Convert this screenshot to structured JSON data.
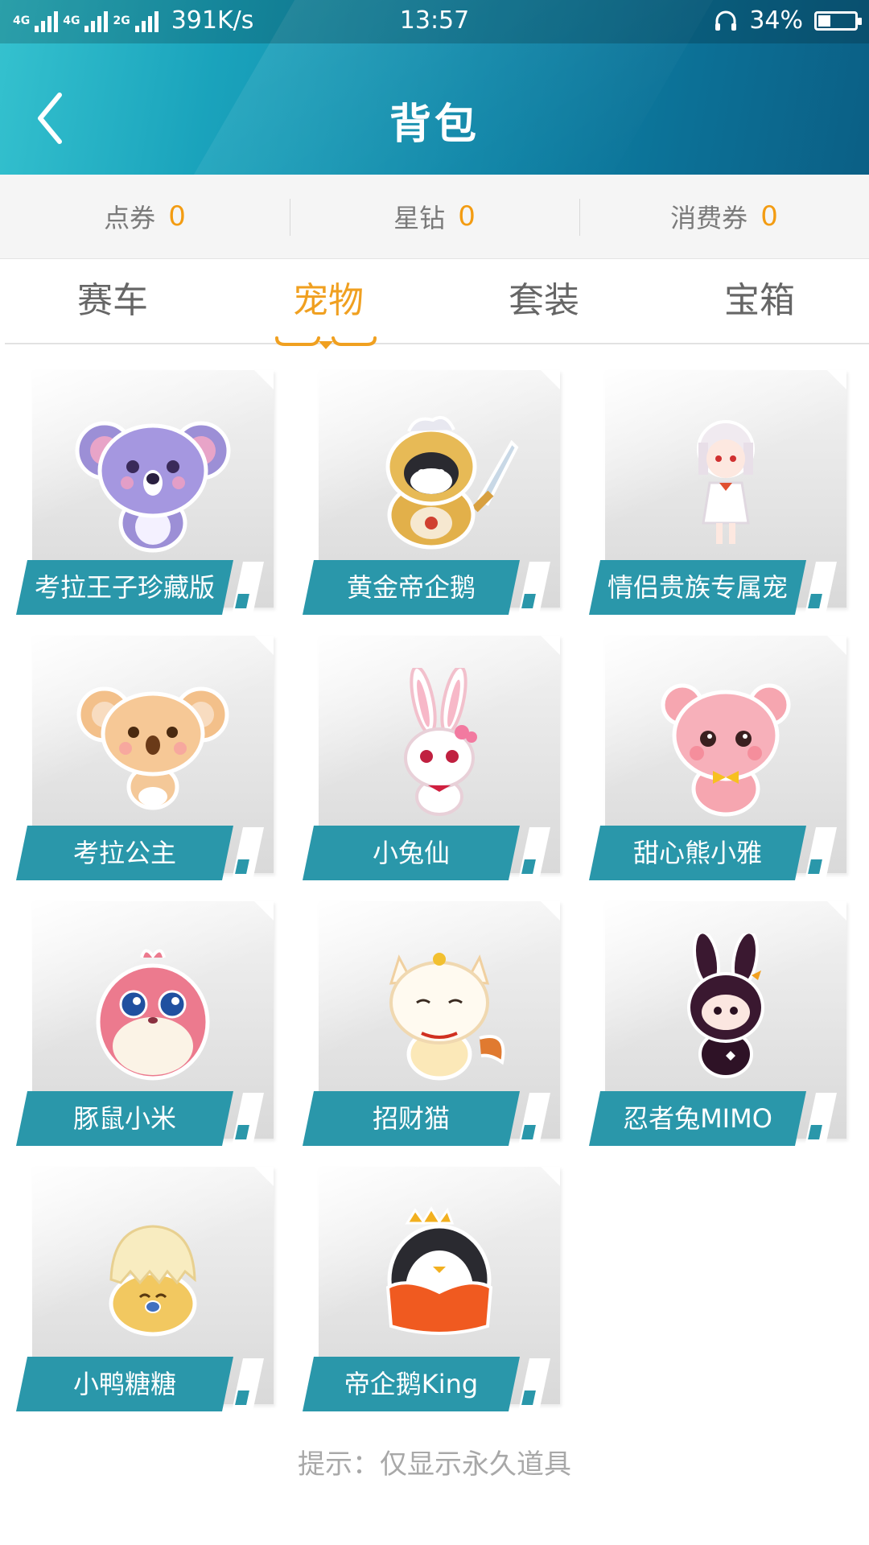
{
  "status_bar": {
    "network_1": "4G",
    "network_2": "4G",
    "network_3": "2G",
    "speed": "391K/s",
    "time": "13:57",
    "battery_percent": "34%",
    "battery_level": 0.34
  },
  "header": {
    "title": "背包",
    "back_icon": "chevron-left-icon"
  },
  "currency": [
    {
      "label": "点券",
      "value": "0"
    },
    {
      "label": "星钻",
      "value": "0"
    },
    {
      "label": "消费券",
      "value": "0"
    }
  ],
  "tabs": [
    {
      "label": "赛车",
      "active": false
    },
    {
      "label": "宠物",
      "active": true
    },
    {
      "label": "套装",
      "active": false
    },
    {
      "label": "宝箱",
      "active": false
    }
  ],
  "pets": [
    {
      "name": "考拉王子珍藏版",
      "icon": "koala-prince-icon"
    },
    {
      "name": "黄金帝企鹅",
      "icon": "golden-penguin-knight-icon"
    },
    {
      "name": "情侣贵族专属宠",
      "icon": "noble-girl-icon"
    },
    {
      "name": "考拉公主",
      "icon": "koala-princess-icon"
    },
    {
      "name": "小兔仙",
      "icon": "bunny-fairy-icon"
    },
    {
      "name": "甜心熊小雅",
      "icon": "pink-bear-icon"
    },
    {
      "name": "豚鼠小米",
      "icon": "guinea-pig-icon"
    },
    {
      "name": "招财猫",
      "icon": "lucky-cat-icon"
    },
    {
      "name": "忍者兔MIMO",
      "icon": "ninja-bunny-icon"
    },
    {
      "name": "小鸭糖糖",
      "icon": "duckling-egg-icon"
    },
    {
      "name": "帝企鹅King",
      "icon": "king-penguin-icon"
    }
  ],
  "hint": "提示：仅显示永久道具",
  "colors": {
    "accent": "#f0a020",
    "label_bg": "#2a97aa",
    "header_start": "#35c2cf",
    "header_end": "#0b5f85"
  }
}
